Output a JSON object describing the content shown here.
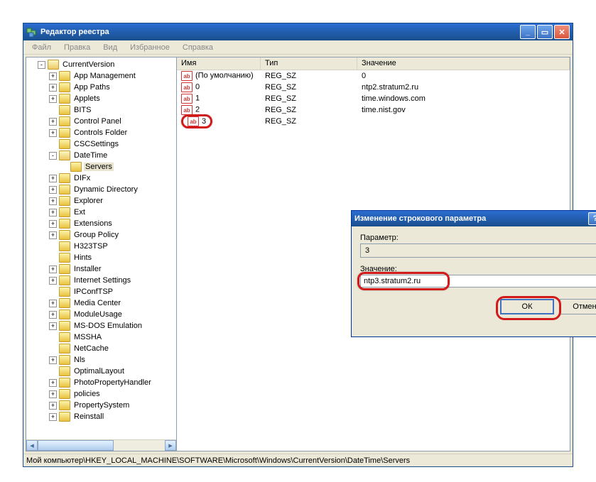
{
  "window": {
    "title": "Редактор реестра"
  },
  "menu": {
    "file": "Файл",
    "edit": "Правка",
    "view": "Вид",
    "favorites": "Избранное",
    "help": "Справка"
  },
  "tree": {
    "items": [
      {
        "indent": 1,
        "exp": "-",
        "icon": "open",
        "label": "CurrentVersion"
      },
      {
        "indent": 2,
        "exp": "+",
        "icon": "closed",
        "label": "App Management"
      },
      {
        "indent": 2,
        "exp": "+",
        "icon": "closed",
        "label": "App Paths"
      },
      {
        "indent": 2,
        "exp": "+",
        "icon": "closed",
        "label": "Applets"
      },
      {
        "indent": 2,
        "exp": "",
        "icon": "closed",
        "label": "BITS"
      },
      {
        "indent": 2,
        "exp": "+",
        "icon": "closed",
        "label": "Control Panel"
      },
      {
        "indent": 2,
        "exp": "+",
        "icon": "closed",
        "label": "Controls Folder"
      },
      {
        "indent": 2,
        "exp": "",
        "icon": "closed",
        "label": "CSCSettings"
      },
      {
        "indent": 2,
        "exp": "-",
        "icon": "open",
        "label": "DateTime"
      },
      {
        "indent": 3,
        "exp": "",
        "icon": "closed",
        "label": "Servers",
        "selected": true
      },
      {
        "indent": 2,
        "exp": "+",
        "icon": "closed",
        "label": "DIFx"
      },
      {
        "indent": 2,
        "exp": "+",
        "icon": "closed",
        "label": "Dynamic Directory"
      },
      {
        "indent": 2,
        "exp": "+",
        "icon": "closed",
        "label": "Explorer"
      },
      {
        "indent": 2,
        "exp": "+",
        "icon": "closed",
        "label": "Ext"
      },
      {
        "indent": 2,
        "exp": "+",
        "icon": "closed",
        "label": "Extensions"
      },
      {
        "indent": 2,
        "exp": "+",
        "icon": "closed",
        "label": "Group Policy"
      },
      {
        "indent": 2,
        "exp": "",
        "icon": "closed",
        "label": "H323TSP"
      },
      {
        "indent": 2,
        "exp": "",
        "icon": "closed",
        "label": "Hints"
      },
      {
        "indent": 2,
        "exp": "+",
        "icon": "closed",
        "label": "Installer"
      },
      {
        "indent": 2,
        "exp": "+",
        "icon": "closed",
        "label": "Internet Settings"
      },
      {
        "indent": 2,
        "exp": "",
        "icon": "closed",
        "label": "IPConfTSP"
      },
      {
        "indent": 2,
        "exp": "+",
        "icon": "closed",
        "label": "Media Center"
      },
      {
        "indent": 2,
        "exp": "+",
        "icon": "closed",
        "label": "ModuleUsage"
      },
      {
        "indent": 2,
        "exp": "+",
        "icon": "closed",
        "label": "MS-DOS Emulation"
      },
      {
        "indent": 2,
        "exp": "",
        "icon": "closed",
        "label": "MSSHA"
      },
      {
        "indent": 2,
        "exp": "",
        "icon": "closed",
        "label": "NetCache"
      },
      {
        "indent": 2,
        "exp": "+",
        "icon": "closed",
        "label": "Nls"
      },
      {
        "indent": 2,
        "exp": "",
        "icon": "closed",
        "label": "OptimalLayout"
      },
      {
        "indent": 2,
        "exp": "+",
        "icon": "closed",
        "label": "PhotoPropertyHandler"
      },
      {
        "indent": 2,
        "exp": "+",
        "icon": "closed",
        "label": "policies"
      },
      {
        "indent": 2,
        "exp": "+",
        "icon": "closed",
        "label": "PropertySystem"
      },
      {
        "indent": 2,
        "exp": "+",
        "icon": "closed",
        "label": "Reinstall"
      }
    ]
  },
  "list": {
    "cols": {
      "name": "Имя",
      "type": "Тип",
      "value": "Значение"
    },
    "rows": [
      {
        "name": "(По умолчанию)",
        "type": "REG_SZ",
        "value": "0"
      },
      {
        "name": "0",
        "type": "REG_SZ",
        "value": "ntp2.stratum2.ru"
      },
      {
        "name": "1",
        "type": "REG_SZ",
        "value": "time.windows.com"
      },
      {
        "name": "2",
        "type": "REG_SZ",
        "value": "time.nist.gov"
      },
      {
        "name": "3",
        "type": "REG_SZ",
        "value": "",
        "highlight": true
      }
    ]
  },
  "status": {
    "path": "Мой компьютер\\HKEY_LOCAL_MACHINE\\SOFTWARE\\Microsoft\\Windows\\CurrentVersion\\DateTime\\Servers"
  },
  "dialog": {
    "title": "Изменение строкового параметра",
    "param_label": "Параметр:",
    "param_value": "3",
    "value_label": "Значение:",
    "value_input": "ntp3.stratum2.ru",
    "ok": "ОК",
    "cancel": "Отмена"
  }
}
